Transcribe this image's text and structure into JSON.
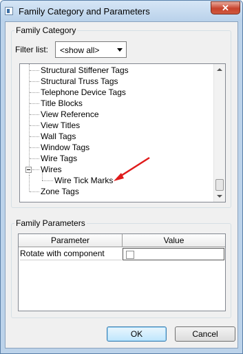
{
  "window": {
    "title": "Family Category and Parameters",
    "close_label": "✕"
  },
  "family_category": {
    "group_label": "Family Category",
    "filter_label": "Filter list:",
    "filter_value": "<show all>",
    "tree_items": [
      "Structural Stiffener Tags",
      "Structural Truss Tags",
      "Telephone Device Tags",
      "Title Blocks",
      "View Reference",
      "View Titles",
      "Wall Tags",
      "Window Tags",
      "Wire Tags",
      "Wires",
      "Wire Tick Marks",
      "Zone Tags"
    ]
  },
  "family_parameters": {
    "group_label": "Family Parameters",
    "columns": [
      "Parameter",
      "Value"
    ],
    "rows": [
      {
        "parameter": "Rotate with component",
        "checked": false
      }
    ]
  },
  "buttons": {
    "ok": "OK",
    "cancel": "Cancel"
  },
  "colors": {
    "annotation_arrow": "#e01b1b",
    "close_button": "#c7432d"
  }
}
